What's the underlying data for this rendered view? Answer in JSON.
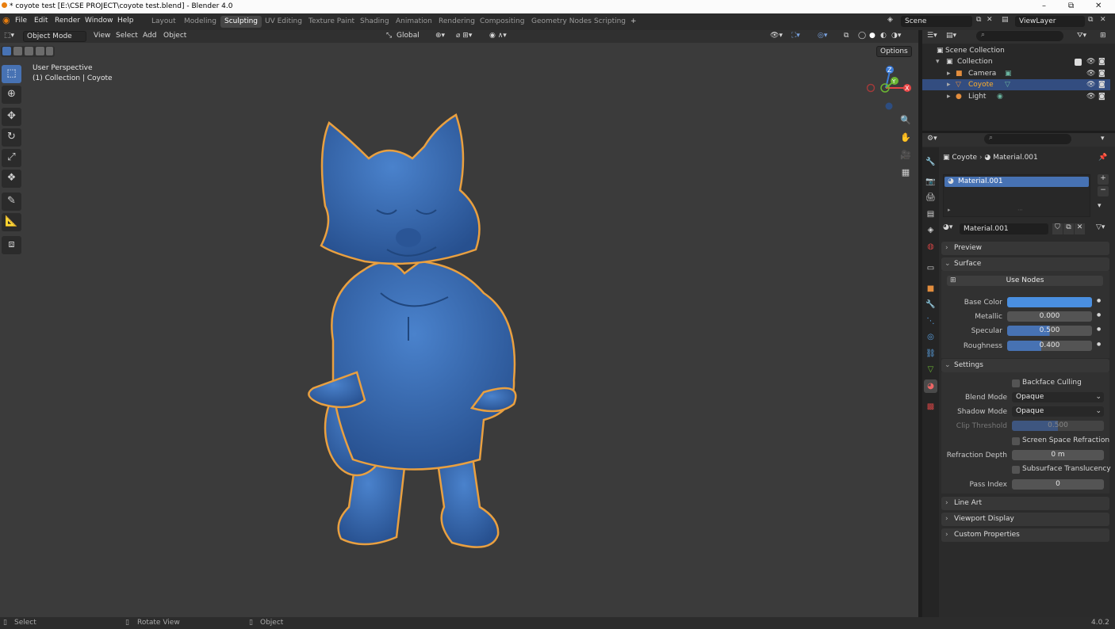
{
  "window": {
    "title": "* coyote test [E:\\CSE PROJECT\\coyote test.blend] - Blender 4.0",
    "minimize": "–",
    "maximize": "⧉",
    "close": "✕"
  },
  "menu": [
    "File",
    "Edit",
    "Render",
    "Window",
    "Help"
  ],
  "workspaces": {
    "tabs": [
      "Layout",
      "Modeling",
      "Sculpting",
      "UV Editing",
      "Texture Paint",
      "Shading",
      "Animation",
      "Rendering",
      "Compositing",
      "Geometry Nodes",
      "Scripting"
    ],
    "active": "Sculpting",
    "add": "+"
  },
  "scene": {
    "name": "Scene",
    "viewlayer": "ViewLayer"
  },
  "viewport": {
    "mode": "Object Mode",
    "menus": [
      "View",
      "Select",
      "Add",
      "Object"
    ],
    "transform_orientation": "Global",
    "options": "Options",
    "overlay_title": "User Perspective",
    "overlay_subtitle": "(1) Collection | Coyote",
    "gizmo": {
      "x": "X",
      "y": "Y",
      "z": "Z"
    },
    "model_color": "#3a6db8",
    "outline_color": "#e9a040",
    "background": "#3b3b3b"
  },
  "tools": [
    "select-box-icon",
    "cursor-icon",
    "move-icon",
    "rotate-icon",
    "scale-icon",
    "transform-icon",
    "annotate-icon",
    "measure-icon",
    "add-cube-icon"
  ],
  "outliner": {
    "root": "Scene Collection",
    "collection": "Collection",
    "items": [
      {
        "name": "Camera",
        "selected": false
      },
      {
        "name": "Coyote",
        "selected": true
      },
      {
        "name": "Light",
        "selected": false
      }
    ]
  },
  "properties": {
    "breadcrumb": {
      "object": "Coyote",
      "material": "Material.001"
    },
    "slot": "Material.001",
    "material_name": "Material.001",
    "panels": {
      "preview": "Preview",
      "surface": "Surface",
      "settings": "Settings",
      "line_art": "Line Art",
      "viewport_display": "Viewport Display",
      "custom_properties": "Custom Properties"
    },
    "use_nodes": "Use Nodes",
    "surface": {
      "base_color_label": "Base Color",
      "base_color": "#4a8fe0",
      "metallic_label": "Metallic",
      "metallic": "0.000",
      "specular_label": "Specular",
      "specular": "0.500",
      "roughness_label": "Roughness",
      "roughness": "0.400"
    },
    "settings": {
      "backface_culling": "Backface Culling",
      "blend_mode_label": "Blend Mode",
      "blend_mode": "Opaque",
      "shadow_mode_label": "Shadow Mode",
      "shadow_mode": "Opaque",
      "clip_threshold_label": "Clip Threshold",
      "clip_threshold": "0.500",
      "ssr": "Screen Space Refraction",
      "refraction_depth_label": "Refraction Depth",
      "refraction_depth": "0 m",
      "subsurface": "Subsurface Translucency",
      "pass_index_label": "Pass Index",
      "pass_index": "0"
    }
  },
  "status": {
    "select": "Select",
    "rotate": "Rotate View",
    "object": "Object",
    "version": "4.0.2"
  }
}
